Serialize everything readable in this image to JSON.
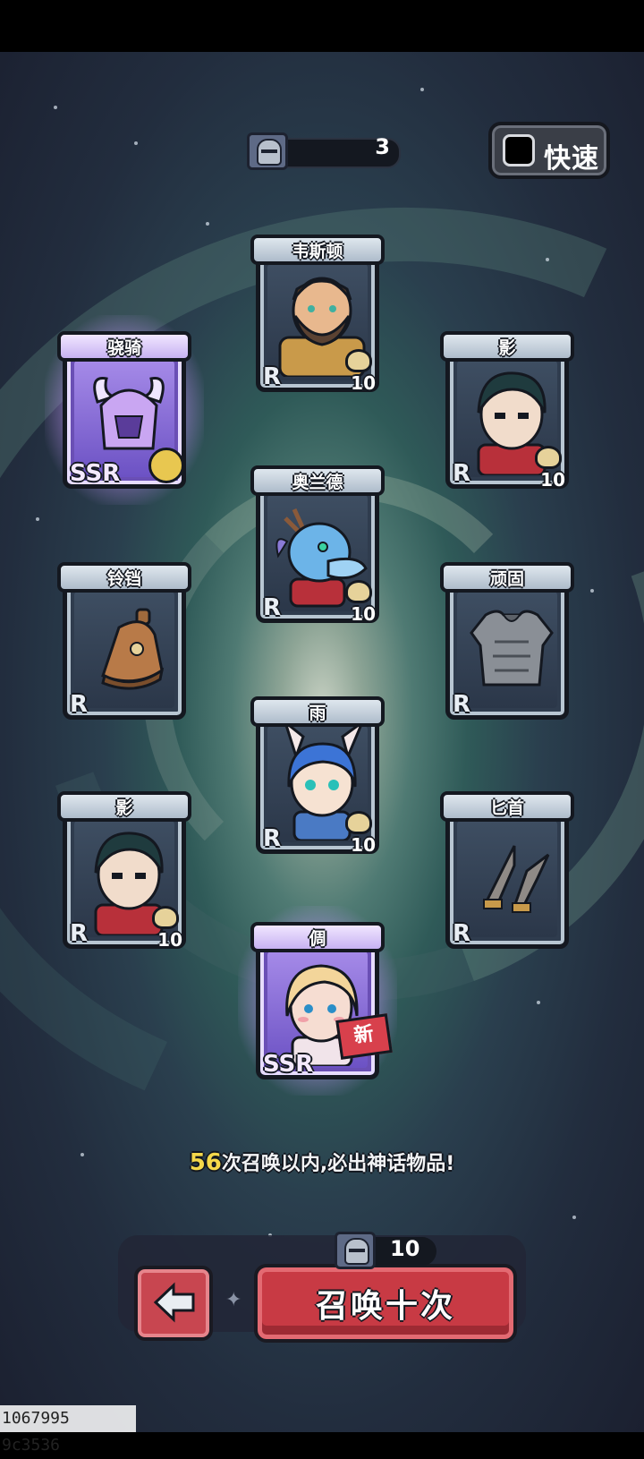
{
  "counter": {
    "value": "3",
    "icon": "helmet-ticket-icon"
  },
  "fast_toggle": {
    "label": "快速",
    "checked": false
  },
  "cards": [
    {
      "name": "韦斯顿",
      "rarity": "R",
      "qty": "10",
      "kind": "hero"
    },
    {
      "name": "骁骑",
      "rarity": "SSR",
      "qty": "",
      "kind": "item"
    },
    {
      "name": "影",
      "rarity": "R",
      "qty": "10",
      "kind": "hero"
    },
    {
      "name": "奥兰德",
      "rarity": "R",
      "qty": "10",
      "kind": "hero"
    },
    {
      "name": "铃铛",
      "rarity": "R",
      "qty": "",
      "kind": "item"
    },
    {
      "name": "顽固",
      "rarity": "R",
      "qty": "",
      "kind": "item"
    },
    {
      "name": "雨",
      "rarity": "R",
      "qty": "10",
      "kind": "hero"
    },
    {
      "name": "影",
      "rarity": "R",
      "qty": "10",
      "kind": "hero"
    },
    {
      "name": "匕首",
      "rarity": "R",
      "qty": "",
      "kind": "item"
    },
    {
      "name": "倜",
      "rarity": "SSR",
      "qty": "",
      "kind": "hero",
      "badge": "新"
    }
  ],
  "pity": {
    "count": "56",
    "text": "次召唤以内,必出神话物品!"
  },
  "summon": {
    "cost": "10",
    "label": "召唤十次"
  },
  "debug": "1067995 9c3536",
  "colors": {
    "summon_red": "#c83a44",
    "ssr_purple": "#a58ae8",
    "pity_yellow": "#f5d84a"
  }
}
